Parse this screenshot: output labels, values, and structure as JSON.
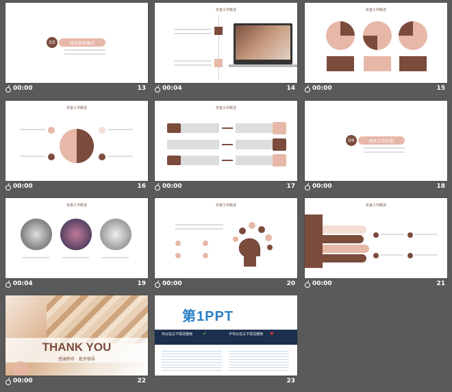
{
  "slides": [
    {
      "number": "13",
      "time": "00:00",
      "section_num": "03",
      "section_title": "成功项目展示"
    },
    {
      "number": "14",
      "time": "00:04",
      "title": "年度工作概述"
    },
    {
      "number": "15",
      "time": "00:00",
      "title": "年度工作概述"
    },
    {
      "number": "16",
      "time": "00:00",
      "title": "年度工作概述"
    },
    {
      "number": "17",
      "time": "00:00",
      "title": "年度工作概述"
    },
    {
      "number": "18",
      "time": "00:00",
      "section_num": "04",
      "section_title": "明年工作计划"
    },
    {
      "number": "19",
      "time": "00:04",
      "title": "年度工作概述"
    },
    {
      "number": "20",
      "time": "00:00",
      "title": "年度工作概述"
    },
    {
      "number": "21",
      "time": "00:00",
      "title": "年度工作概述"
    },
    {
      "number": "22",
      "time": "00:00",
      "thank_you": "THANK YOU",
      "subtitle": "感谢聆听 · 批评指导"
    },
    {
      "number": "23",
      "time": "",
      "logo": "第1PPT",
      "left_header": "可以在以下情况使用",
      "right_header": "不可以在以下情况使用"
    }
  ],
  "colors": {
    "brown": "#7b4b3c",
    "pink": "#e7b7a8",
    "navy": "#1c2f4d",
    "blue": "#2a7fc7"
  }
}
